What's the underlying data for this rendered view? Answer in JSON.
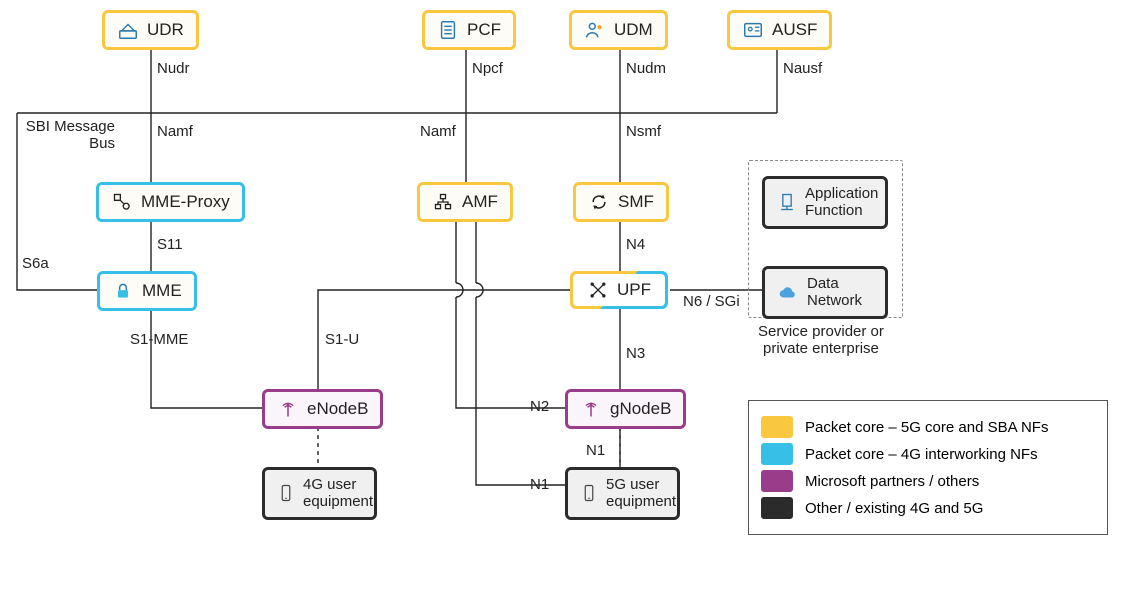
{
  "nodes": {
    "udr": "UDR",
    "pcf": "PCF",
    "udm": "UDM",
    "ausf": "AUSF",
    "mmeProxy": "MME-Proxy",
    "amf": "AMF",
    "smf": "SMF",
    "appFn": "Application\nFunction",
    "mme": "MME",
    "upf": "UPF",
    "dataNet": "Data\nNetwork",
    "enodeb": "eNodeB",
    "gnodeb": "gNodeB",
    "ue4g": "4G user\nequipment",
    "ue5g": "5G user\nequipment"
  },
  "labels": {
    "nudr": "Nudr",
    "npcf": "Npcf",
    "nudm": "Nudm",
    "nausf": "Nausf",
    "sbi": "SBI Message\nBus",
    "namf1": "Namf",
    "namf2": "Namf",
    "nsmf": "Nsmf",
    "s11": "S11",
    "s6a": "S6a",
    "n4": "N4",
    "s1mme": "S1-MME",
    "s1u": "S1-U",
    "n6sgi": "N6 / SGi",
    "n3": "N3",
    "n2": "N2",
    "n1a": "N1",
    "n1b": "N1",
    "svcProvider": "Service provider or\nprivate enterprise"
  },
  "legend": {
    "row1": "Packet core – 5G core and SBA NFs",
    "row2": "Packet core – 4G interworking NFs",
    "row3": "Microsoft partners / others",
    "row4": "Other / existing 4G and 5G"
  }
}
